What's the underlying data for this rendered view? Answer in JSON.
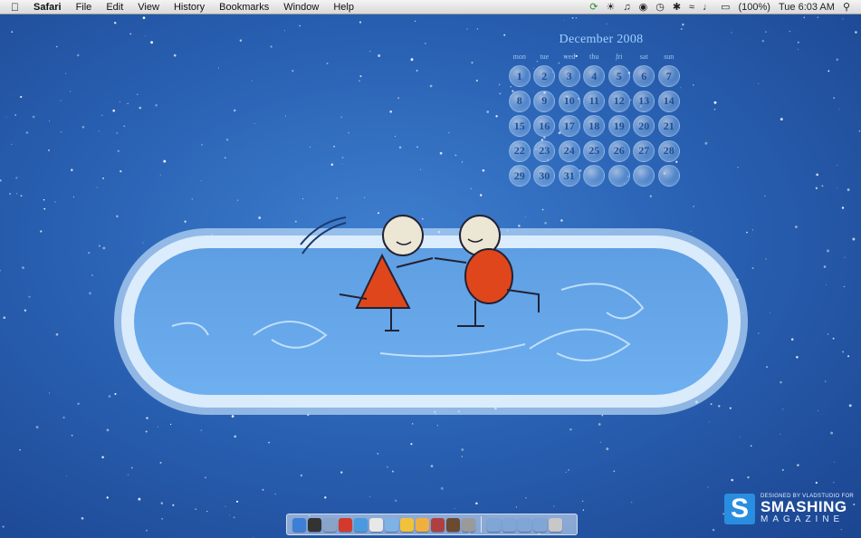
{
  "menubar": {
    "app_name": "Safari",
    "menus": [
      "File",
      "Edit",
      "View",
      "History",
      "Bookmarks",
      "Window",
      "Help"
    ],
    "battery": "(100%)",
    "clock": "Tue 6:03 AM"
  },
  "calendar": {
    "month_label": "December 2008",
    "weekdays": [
      "mon",
      "tue",
      "wed",
      "thu",
      "fri",
      "sat",
      "sun"
    ],
    "days": [
      "1",
      "2",
      "3",
      "4",
      "5",
      "6",
      "7",
      "8",
      "9",
      "10",
      "11",
      "12",
      "13",
      "14",
      "15",
      "16",
      "17",
      "18",
      "19",
      "20",
      "21",
      "22",
      "23",
      "24",
      "25",
      "26",
      "27",
      "28",
      "29",
      "30",
      "31",
      "",
      "",
      "",
      ""
    ]
  },
  "credit": {
    "designed_by": "DESIGNED BY VLADSTUDIO FOR",
    "brand_top": "SMASHING",
    "brand_bottom": "MAGAZINE",
    "brand_mark": "S"
  },
  "dock": {
    "apps": [
      {
        "icon": "finder-icon",
        "color": "#3d7fd6"
      },
      {
        "icon": "dashboard-icon",
        "color": "#333333"
      },
      {
        "icon": "textedit-icon",
        "color": "#8aa4c8"
      },
      {
        "icon": "gmail-icon",
        "color": "#d33a2c"
      },
      {
        "icon": "safari-icon",
        "color": "#4a9ae0"
      },
      {
        "icon": "ical-icon",
        "color": "#e8e8e8"
      },
      {
        "icon": "itunes-icon",
        "color": "#7fb3e6"
      },
      {
        "icon": "adium-icon",
        "color": "#f2c13a"
      },
      {
        "icon": "notes-icon",
        "color": "#f0b040"
      },
      {
        "icon": "addressbook-icon",
        "color": "#b04040"
      },
      {
        "icon": "photobooth-icon",
        "color": "#6b4a2f"
      },
      {
        "icon": "system-preferences-icon",
        "color": "#9a9a9a"
      }
    ],
    "stacks": [
      {
        "icon": "folder-icon",
        "color": "#7fa6d6"
      },
      {
        "icon": "folder-icon",
        "color": "#7fa6d6"
      },
      {
        "icon": "folder-icon",
        "color": "#7fa6d6"
      },
      {
        "icon": "downloads-icon",
        "color": "#7fa6d6"
      },
      {
        "icon": "trash-icon",
        "color": "#c8c8c8"
      }
    ]
  }
}
